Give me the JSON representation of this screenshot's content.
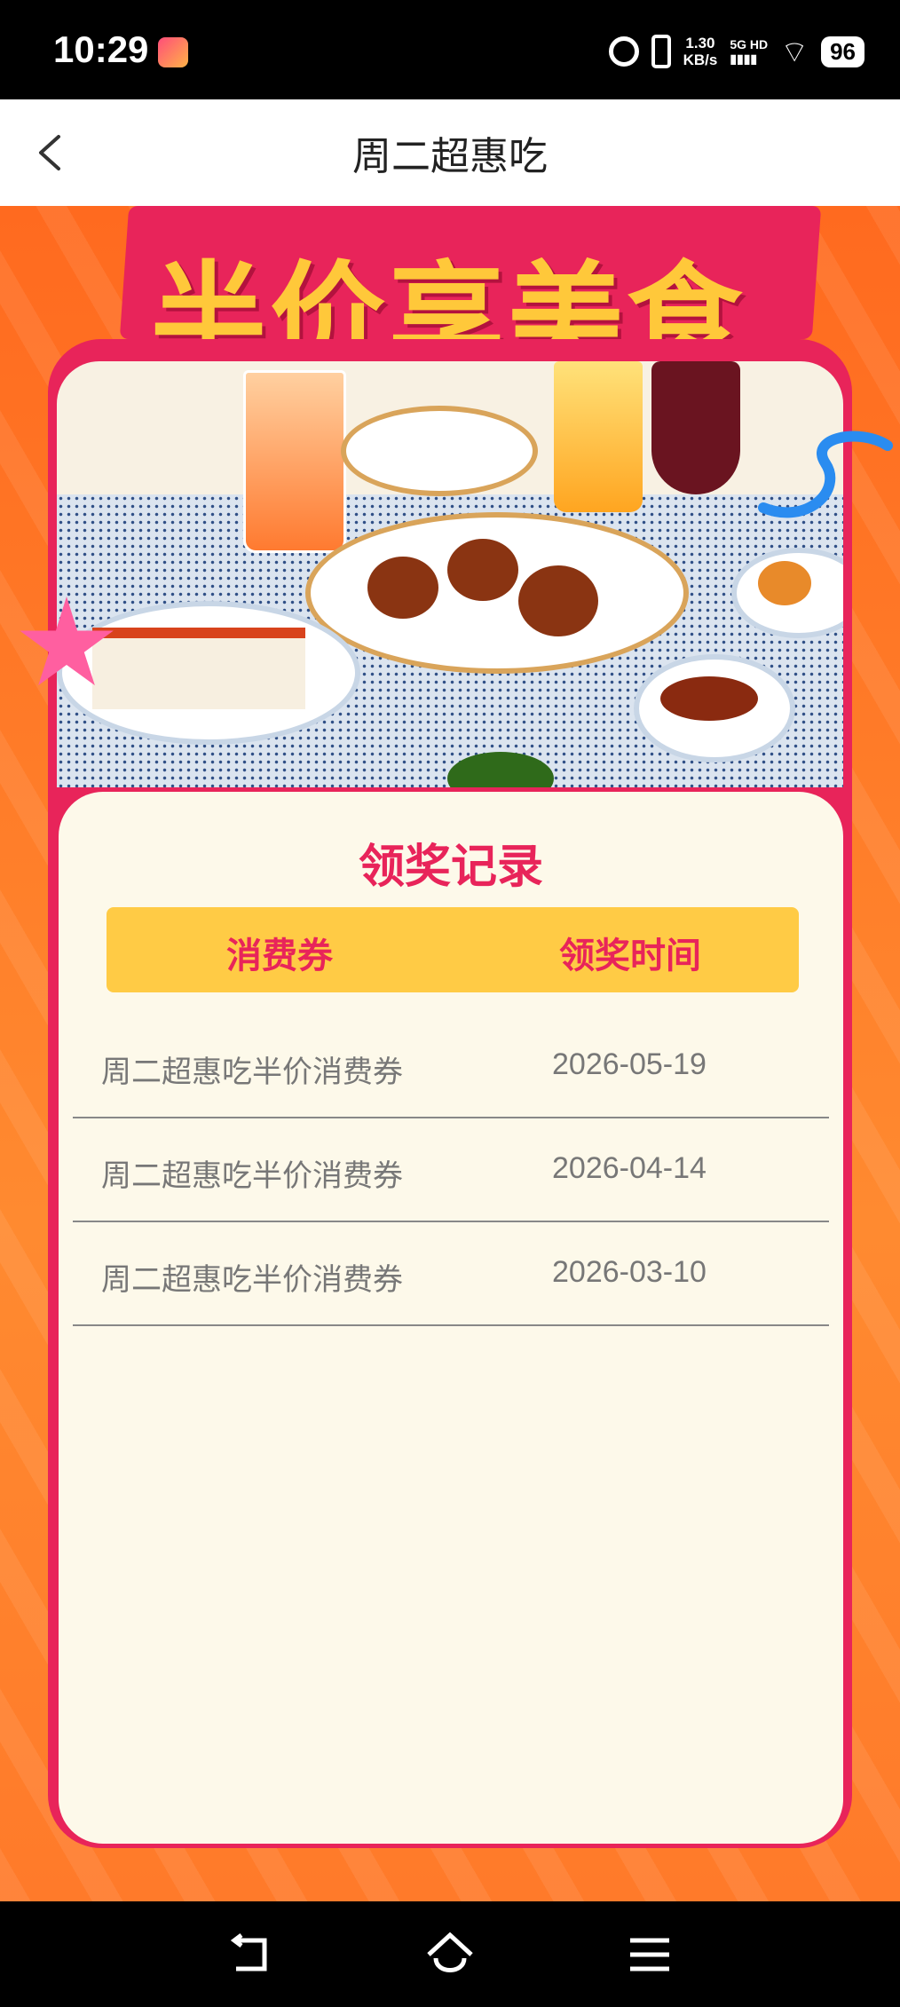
{
  "status": {
    "time": "10:29",
    "speed_value": "1.30",
    "speed_unit": "KB/s",
    "network": "5G HD",
    "battery": "96"
  },
  "nav": {
    "title": "周二超惠吃"
  },
  "banner": {
    "title": "半价享美食"
  },
  "records": {
    "title": "领奖记录",
    "columns": [
      "消费券",
      "领奖时间"
    ],
    "rows": [
      {
        "name": "周二超惠吃半价消费券",
        "date": "2026-05-19"
      },
      {
        "name": "周二超惠吃半价消费券",
        "date": "2026-04-14"
      },
      {
        "name": "周二超惠吃半价消费券",
        "date": "2026-03-10"
      }
    ]
  },
  "colors": {
    "accent": "#e8245a",
    "header_bg": "#ffcb45",
    "background": "#ff7a2a",
    "card_bg": "#fdf9ea"
  }
}
